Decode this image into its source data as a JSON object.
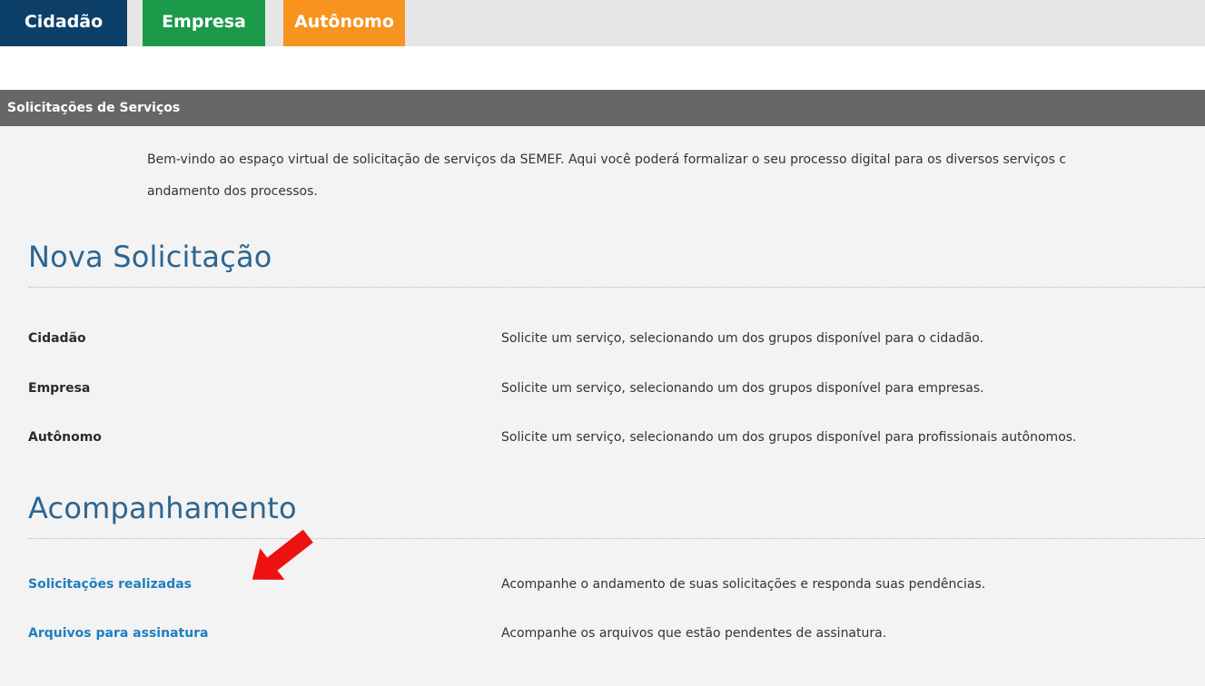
{
  "tabs": {
    "cidadao": "Cidadão",
    "empresa": "Empresa",
    "autonomo": "Autônomo"
  },
  "section_header": "Solicitações de Serviços",
  "intro": {
    "line1": "Bem-vindo ao espaço virtual de solicitação de serviços da SEMEF. Aqui você poderá formalizar o seu processo digital para os diversos serviços c",
    "line2": "andamento dos processos."
  },
  "nova_solicitacao": {
    "title": "Nova Solicitação",
    "items": [
      {
        "label": "Cidadão",
        "desc": "Solicite um serviço, selecionando um dos grupos disponível para o cidadão."
      },
      {
        "label": "Empresa",
        "desc": "Solicite um serviço, selecionando um dos grupos disponível para empresas."
      },
      {
        "label": "Autônomo",
        "desc": "Solicite um serviço, selecionando um dos grupos disponível para profissionais autônomos."
      }
    ]
  },
  "acompanhamento": {
    "title": "Acompanhamento",
    "items": [
      {
        "label": "Solicitações realizadas",
        "desc": "Acompanhe o andamento de suas solicitações e responda suas pendências."
      },
      {
        "label": "Arquivos para assinatura",
        "desc": "Acompanhe os arquivos que estão pendentes de assinatura."
      }
    ]
  },
  "annotation": {
    "icon": "red-arrow-icon",
    "color": "#ee1111"
  }
}
